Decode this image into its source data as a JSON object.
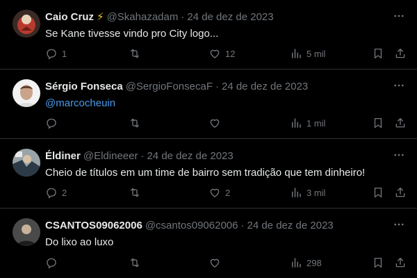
{
  "tweets": [
    {
      "name": "Caio Cruz",
      "badge_icon": "lightning-icon",
      "handle": "@Skahazadam",
      "separator": "·",
      "date": "24 de dez de 2023",
      "text": "Se Kane tivesse vindo pro City logo...",
      "replies": "1",
      "retweets": "",
      "likes": "12",
      "views": "5 mil"
    },
    {
      "name": "Sérgio Fonseca",
      "handle": "@SergioFonsecaF",
      "separator": "·",
      "date": "24 de dez de 2023",
      "text": "@marcocheuin",
      "replies": "",
      "retweets": "",
      "likes": "",
      "views": "1 mil"
    },
    {
      "name": "Éldiner",
      "handle": "@Eldineeer",
      "separator": "·",
      "date": "24 de dez de 2023",
      "text": "Cheio de títulos em um time de bairro sem tradição que tem dinheiro!",
      "replies": "2",
      "retweets": "",
      "likes": "2",
      "views": "3 mil"
    },
    {
      "name": "CSANTOS09062006",
      "handle": "@csantos09062006",
      "separator": "·",
      "date": "24 de dez de 2023",
      "text": "Do lixo ao luxo",
      "replies": "",
      "retweets": "",
      "likes": "",
      "views": "298"
    }
  ],
  "colors": {
    "background": "#000000",
    "text": "#e7e9ea",
    "muted": "#71767b",
    "link": "#4a99e9",
    "divider": "#2f3336"
  }
}
